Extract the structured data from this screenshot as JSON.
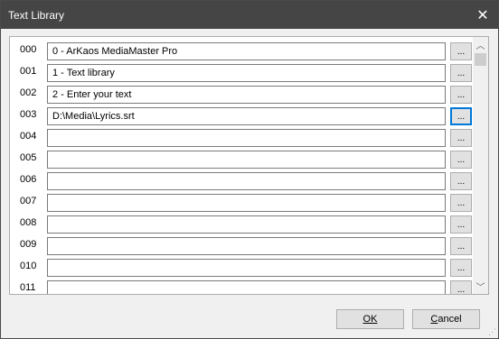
{
  "window": {
    "title": "Text Library",
    "close_glyph": "✕"
  },
  "rows": [
    {
      "num": "000",
      "value": "0 - ArKaos MediaMaster Pro",
      "browse": "..."
    },
    {
      "num": "001",
      "value": "1 - Text library",
      "browse": "..."
    },
    {
      "num": "002",
      "value": "2 - Enter your text",
      "browse": "..."
    },
    {
      "num": "003",
      "value": "D:\\Media\\Lyrics.srt",
      "browse": "..."
    },
    {
      "num": "004",
      "value": "",
      "browse": "..."
    },
    {
      "num": "005",
      "value": "",
      "browse": "..."
    },
    {
      "num": "006",
      "value": "",
      "browse": "..."
    },
    {
      "num": "007",
      "value": "",
      "browse": "..."
    },
    {
      "num": "008",
      "value": "",
      "browse": "..."
    },
    {
      "num": "009",
      "value": "",
      "browse": "..."
    },
    {
      "num": "010",
      "value": "",
      "browse": "..."
    },
    {
      "num": "011",
      "value": "",
      "browse": "..."
    }
  ],
  "focused_row": "003",
  "scrollbar": {
    "up_glyph": "︿",
    "down_glyph": "﹀"
  },
  "buttons": {
    "ok": "OK",
    "cancel": "Cancel"
  },
  "colors": {
    "titlebar": "#454545",
    "focus": "#0078d7"
  }
}
